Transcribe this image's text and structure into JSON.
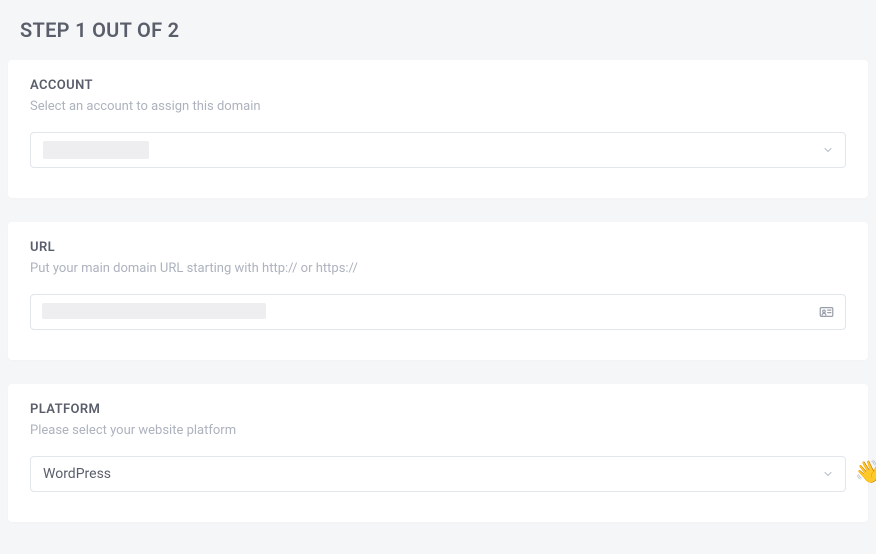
{
  "step_title": "STEP 1 OUT OF 2",
  "account_card": {
    "title": "ACCOUNT",
    "subtitle": "Select an account to assign this domain",
    "selected_value": ""
  },
  "url_card": {
    "title": "URL",
    "subtitle": "Put your main domain URL starting with http:// or https://",
    "value": ""
  },
  "platform_card": {
    "title": "PLATFORM",
    "subtitle": "Please select your website platform",
    "selected_value": "WordPress"
  },
  "wave_emoji": "👋"
}
